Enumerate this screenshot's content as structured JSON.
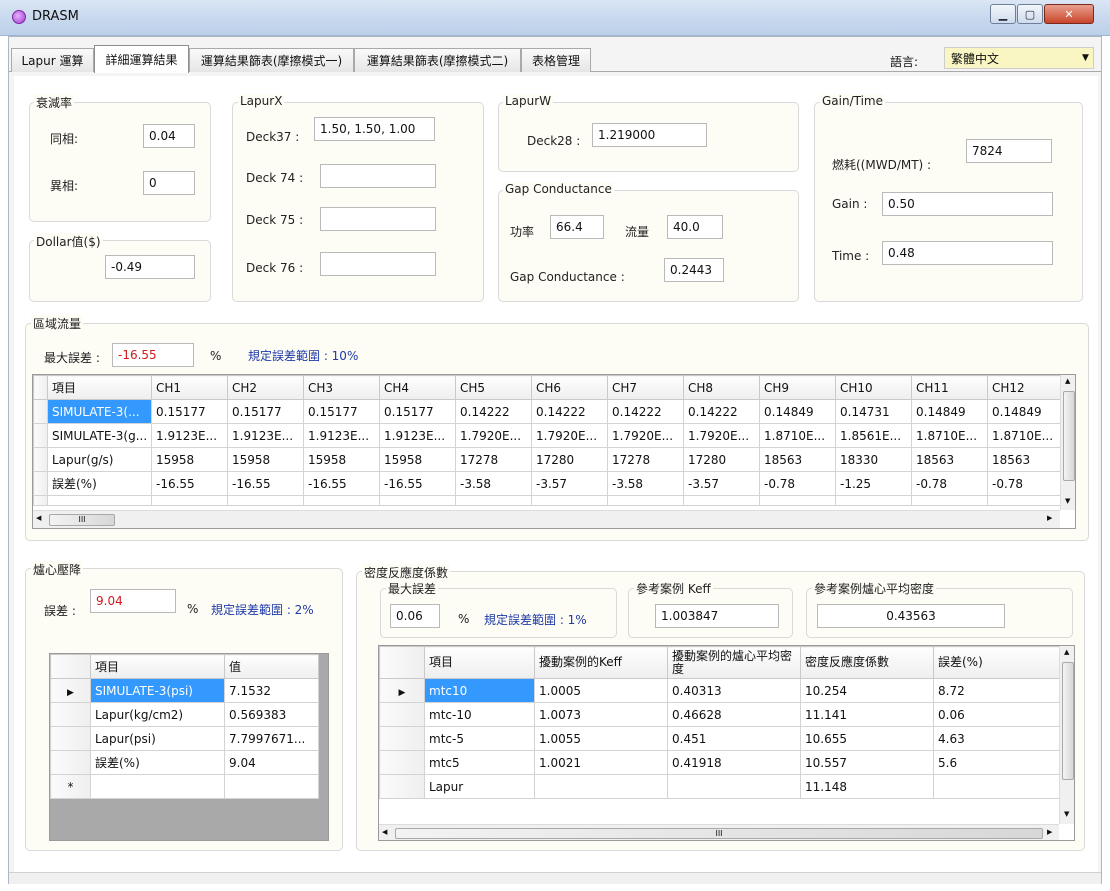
{
  "window": {
    "title": "DRASM"
  },
  "tabs": [
    "Lapur 運算",
    "詳細運算結果",
    "運算結果篩表(摩擦模式一)",
    "運算結果篩表(摩擦模式二)",
    "表格管理"
  ],
  "language": {
    "label": "語言:",
    "value": "繁體中文"
  },
  "decay": {
    "title": "衰減率",
    "same_label": "同相:",
    "same_value": "0.04",
    "diff_label": "異相:",
    "diff_value": "0"
  },
  "dollar": {
    "title": "Dollar值($)",
    "value": "-0.49"
  },
  "lapurx": {
    "title": "LapurX",
    "deck37_label": "Deck37 :",
    "deck37_value": "1.50, 1.50, 1.00",
    "deck74_label": "Deck 74 :",
    "deck74_value": "",
    "deck75_label": "Deck 75 :",
    "deck75_value": "",
    "deck76_label": "Deck 76 :",
    "deck76_value": ""
  },
  "lapurw": {
    "title": "LapurW",
    "deck28_label": "Deck28 :",
    "deck28_value": "1.219000"
  },
  "gap": {
    "title": "Gap Conductance",
    "power_label": "功率",
    "power_value": "66.4",
    "flow_label": "流量",
    "flow_value": "40.0",
    "gc_label": "Gap Conductance :",
    "gc_value": "0.2443"
  },
  "gaintime": {
    "title": "Gain/Time",
    "burnup_label": "燃耗((MWD/MT) :",
    "burnup_value": "7824",
    "gain_label": "Gain :",
    "gain_value": "0.50",
    "time_label": "Time :",
    "time_value": "0.48"
  },
  "regional": {
    "title": "區域流量",
    "maxerr_label": "最大誤差 :",
    "maxerr_value": "-16.55",
    "pct": "%",
    "range_text": "規定誤差範圍 : 10%",
    "columns": [
      "項目",
      "CH1",
      "CH2",
      "CH3",
      "CH4",
      "CH5",
      "CH6",
      "CH7",
      "CH8",
      "CH9",
      "CH10",
      "CH11",
      "CH12"
    ],
    "rows": [
      [
        "SIMULATE-3(...",
        "0.15177",
        "0.15177",
        "0.15177",
        "0.15177",
        "0.14222",
        "0.14222",
        "0.14222",
        "0.14222",
        "0.14849",
        "0.14731",
        "0.14849",
        "0.14849"
      ],
      [
        "SIMULATE-3(g...",
        "1.9123E...",
        "1.9123E...",
        "1.9123E...",
        "1.9123E...",
        "1.7920E...",
        "1.7920E...",
        "1.7920E...",
        "1.7920E...",
        "1.8710E...",
        "1.8561E...",
        "1.8710E...",
        "1.8710E..."
      ],
      [
        "Lapur(g/s)",
        "15958",
        "15958",
        "15958",
        "15958",
        "17278",
        "17280",
        "17278",
        "17280",
        "18563",
        "18330",
        "18563",
        "18563"
      ],
      [
        "誤差(%)",
        "-16.55",
        "-16.55",
        "-16.55",
        "-16.55",
        "-3.58",
        "-3.57",
        "-3.58",
        "-3.57",
        "-0.78",
        "-1.25",
        "-0.78",
        "-0.78"
      ]
    ],
    "scroll_thumb": "III"
  },
  "pressure": {
    "title": "爐心壓降",
    "err_label": "誤差 :",
    "err_value": "9.04",
    "pct": "%",
    "range_text": "規定誤差範圍 : 2%",
    "columns": [
      "項目",
      "值"
    ],
    "rows": [
      [
        "SIMULATE-3(psi)",
        "7.1532"
      ],
      [
        "Lapur(kg/cm2)",
        "0.569383"
      ],
      [
        "Lapur(psi)",
        "7.7997671..."
      ],
      [
        "誤差(%)",
        "9.04"
      ]
    ],
    "new_row_marker": "*",
    "current_marker": "▶"
  },
  "density": {
    "title": "密度反應度係數",
    "maxerr_title": "最大誤差",
    "maxerr_value": "0.06",
    "pct": "%",
    "range_text": "規定誤差範圍 : 1%",
    "keff_title": "參考案例 Keff",
    "keff_value": "1.003847",
    "avgdens_title": "參考案例爐心平均密度",
    "avgdens_value": "0.43563",
    "columns": [
      "項目",
      "擾動案例的Keff",
      "擾動案例的爐心平均密度",
      "密度反應度係數",
      "誤差(%)"
    ],
    "rows": [
      [
        "mtc10",
        "1.0005",
        "0.40313",
        "10.254",
        "8.72"
      ],
      [
        "mtc-10",
        "1.0073",
        "0.46628",
        "11.141",
        "0.06"
      ],
      [
        "mtc-5",
        "1.0055",
        "0.451",
        "10.655",
        "4.63"
      ],
      [
        "mtc5",
        "1.0021",
        "0.41918",
        "10.557",
        "5.6"
      ],
      [
        "Lapur",
        "",
        "",
        "11.148",
        ""
      ]
    ],
    "current_marker": "▶",
    "scroll_thumb": "III"
  }
}
